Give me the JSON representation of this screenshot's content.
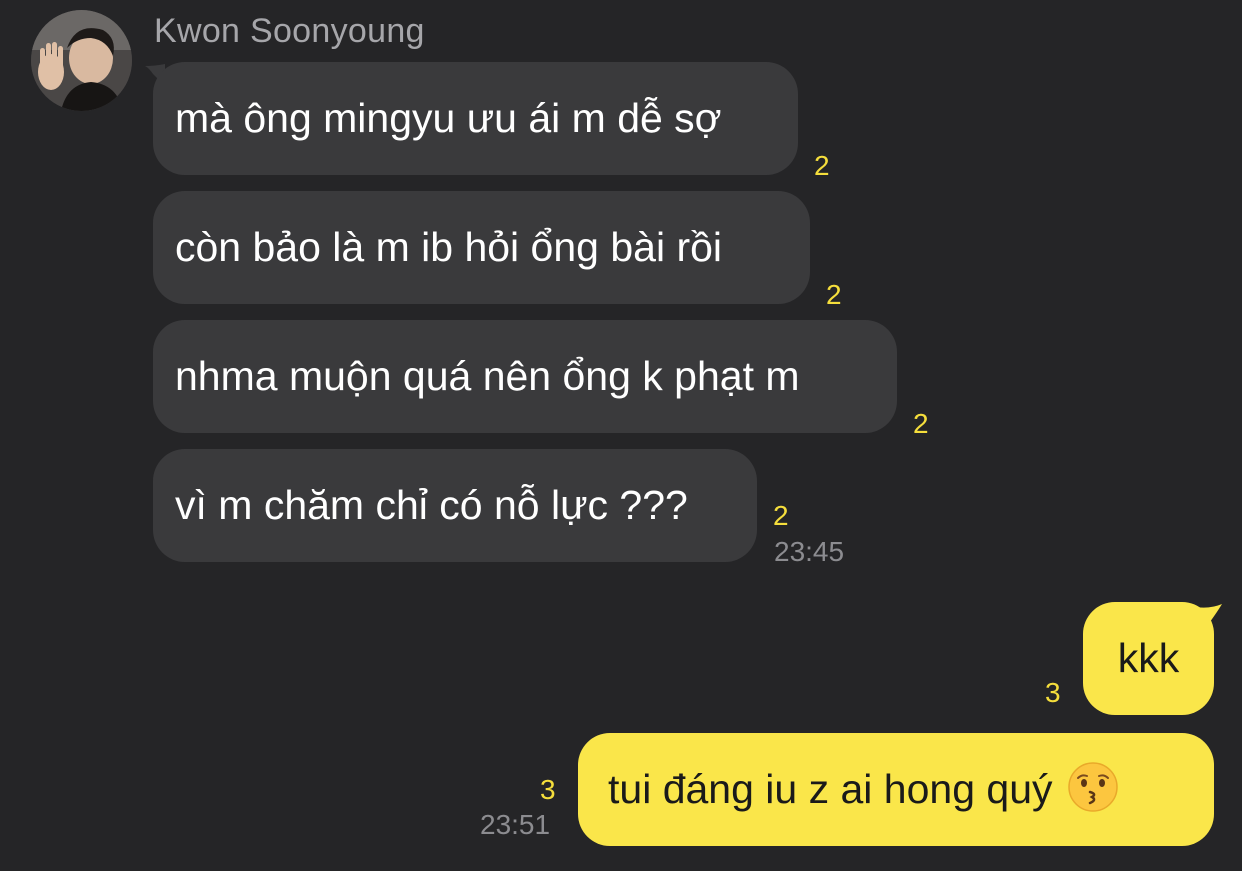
{
  "conversation": {
    "sender_name": "Kwon Soonyoung",
    "incoming": [
      {
        "text": "mà ông mingyu ưu ái m dễ sợ",
        "unread": "2"
      },
      {
        "text": "còn bảo là m ib hỏi ổng bài rồi",
        "unread": "2"
      },
      {
        "text": "nhma muộn quá nên ổng k phạt m",
        "unread": "2"
      },
      {
        "text": "vì m chăm chỉ có nỗ lực ???",
        "unread": "2",
        "time": "23:45"
      }
    ],
    "outgoing": [
      {
        "text": "kkk",
        "unread": "3"
      },
      {
        "text": "tui đáng iu z ai hong quý",
        "emoji": "kissing-face-emoji",
        "unread": "3",
        "time": "23:51"
      }
    ]
  },
  "colors": {
    "background": "#252527",
    "incoming_bubble": "#3a3a3c",
    "outgoing_bubble": "#fae64a",
    "unread_count": "#f5de3c",
    "timestamp": "#8c8c90"
  }
}
